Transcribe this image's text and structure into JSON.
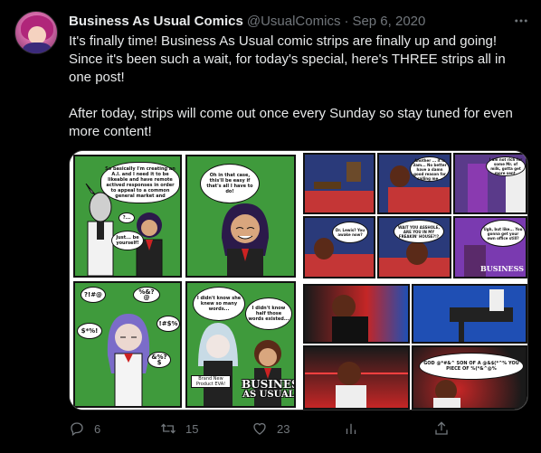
{
  "tweet": {
    "author_name": "Business As Usual Comics",
    "handle": "@UsualComics",
    "separator": "·",
    "date": "Sep 6, 2020",
    "more_icon": "more-icon",
    "paragraph_1": "It's finally time! Business As Usual comic strips are finally up and going! Since it's been such a wait, for today's special, here's THREE strips all in one post!",
    "paragraph_2": "After today, strips will come out once every Sunday so stay tuned for even more content!"
  },
  "comic_left": {
    "bubble_1": "So basically I'm creating an A.I. and I need it to be likeable and have remote actived responses in order to appeal to a common general market and",
    "bubble_2": "?...",
    "bubble_3": "Just... be yourself!",
    "bubble_4": "Oh in that case, this'll be easy if that's all I have to do!",
    "bubble_5": "?!#@",
    "bubble_6": "%&?@",
    "bubble_7": "!#$%",
    "bubble_8": "$*%!",
    "bubble_9": "&%?$",
    "bubble_10": "I didn't know she knew so many words...",
    "bubble_11": "I didn't know half those words existed...",
    "caption": "Brand New Product EVA!",
    "logo_line_1": "BUSINESS",
    "logo_line_2": "AS USUAL"
  },
  "comic_right_top": {
    "bubble_1": "Another ... it is 3am... No better have a damn good reason for calling me...",
    "bubble_2": "Dr. Lewis? You awake now?",
    "bubble_3": "WAIT YOU ASSHOLE, ARE YOU IN MY FREAKIN' HOUSE?!?",
    "bubble_4": "Ugh, but like... You gonna get your own office still?",
    "bubble_5": "I am not rich for some Mr. of milk, gotta get more sent.",
    "logo_text": "BUSINESS"
  },
  "comic_right_bottom": {
    "bubble_1": "GOD @*#&^ SON OF A @&$(*^% YOU PIECE OF %(*&^@%"
  },
  "actions": {
    "reply_count": "6",
    "retweet_count": "15",
    "like_count": "23",
    "reply_icon": "reply-icon",
    "retweet_icon": "retweet-icon",
    "like_icon": "heart-icon",
    "views_icon": "analytics-icon",
    "share_icon": "share-icon"
  },
  "colors": {
    "background": "#000000",
    "text_primary": "#e7e9ea",
    "text_secondary": "#71767b",
    "comic_green": "#3f9a3c",
    "comic_red": "#d9262c",
    "comic_blue": "#1f4fb4"
  }
}
